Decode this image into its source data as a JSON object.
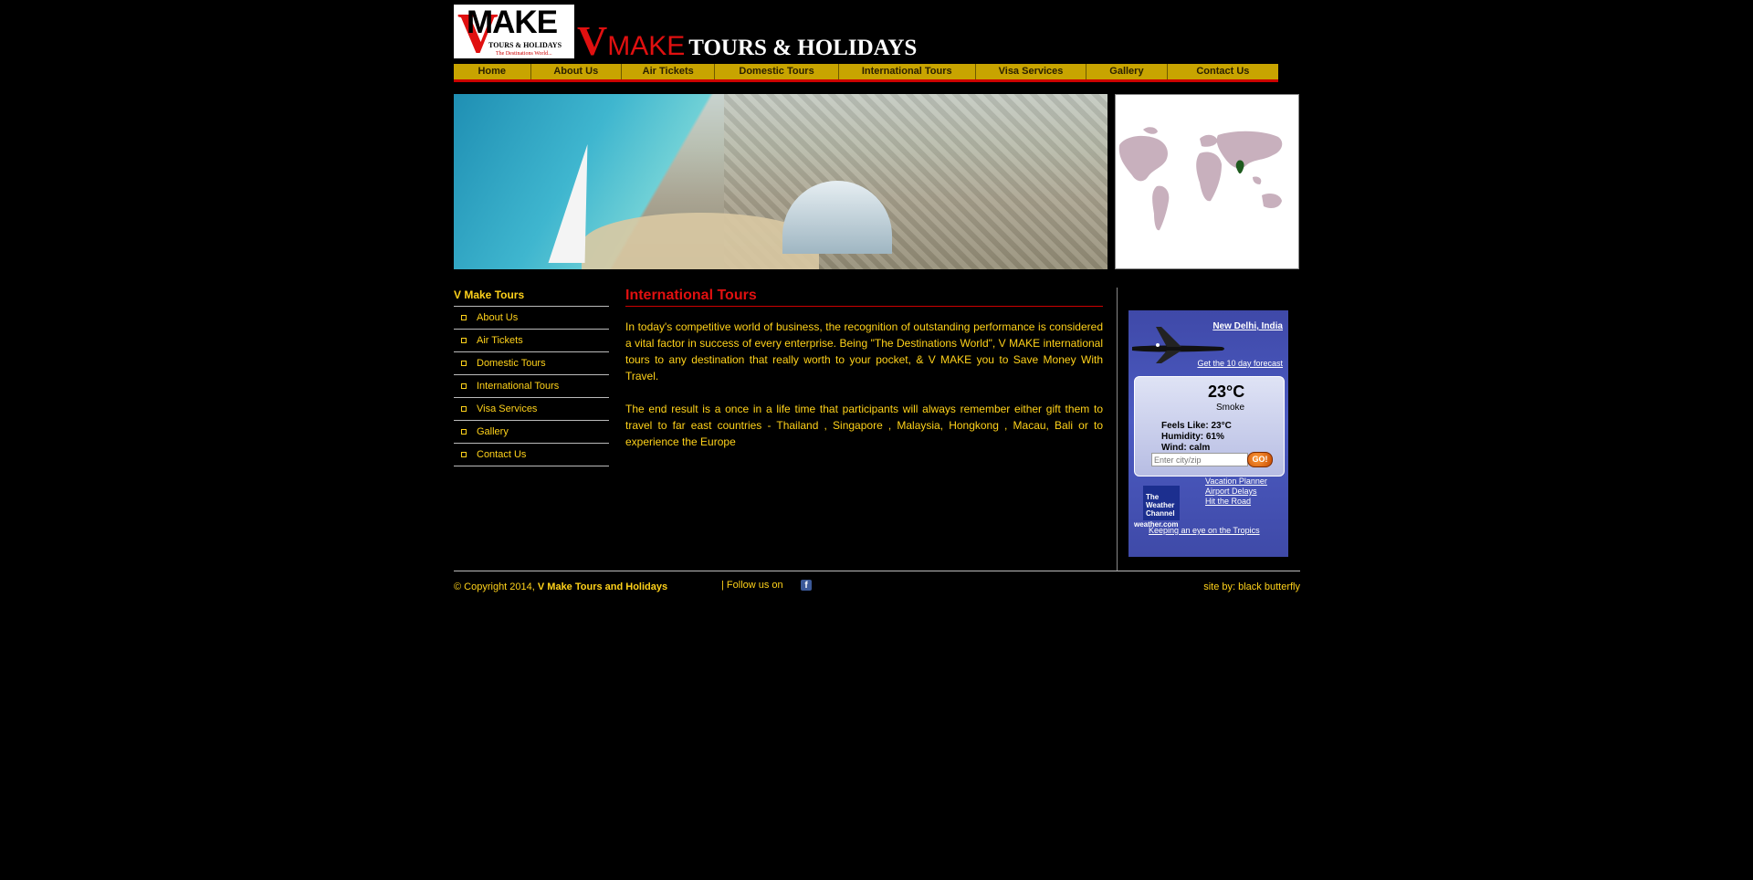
{
  "header": {
    "logo": {
      "v": "V",
      "make": "MAKE",
      "sub1": "TOURS & HOLIDAYS",
      "sub2": "The Destinations World..."
    },
    "brand": {
      "v": "V",
      "make": "MAKE",
      "rest": "TOURS & HOLIDAYS"
    }
  },
  "nav": {
    "items": [
      {
        "label": "Home"
      },
      {
        "label": "About Us"
      },
      {
        "label": "Air Tickets"
      },
      {
        "label": "Domestic Tours"
      },
      {
        "label": "International Tours"
      },
      {
        "label": "Visa Services"
      },
      {
        "label": "Gallery"
      },
      {
        "label": "Contact Us"
      }
    ]
  },
  "sidebar": {
    "title": "V Make Tours",
    "items": [
      {
        "label": "About Us"
      },
      {
        "label": "Air Tickets"
      },
      {
        "label": "Domestic Tours"
      },
      {
        "label": "International Tours"
      },
      {
        "label": "Visa Services"
      },
      {
        "label": "Gallery"
      },
      {
        "label": "Contact Us"
      }
    ]
  },
  "content": {
    "title": "International Tours",
    "p1": "In today's competitive world of business, the recognition of outstanding performance is considered a vital factor in success of every enterprise. Being \"The Destinations World\", V MAKE international tours to any destination that really worth to your pocket, & V MAKE you to Save Money With Travel.",
    "p2": "The end result is a once in a life time that participants will always remember either gift them to travel to far east countries - Thailand , Singapore , Malaysia, Hongkong , Macau, Bali or to experience the Europe"
  },
  "weather": {
    "city": "New Delhi, India",
    "forecast_link": "Get the 10 day forecast",
    "temp": "23°C",
    "condition": "Smoke",
    "feels": "Feels Like: 23°C",
    "humidity": "Humidity: 61%",
    "wind": "Wind: calm",
    "input_placeholder": "Enter city/zip",
    "go": "GO!",
    "logo": {
      "line1": "The",
      "line2": "Weather",
      "line3": "Channel",
      "site": "weather.com"
    },
    "links": [
      "Vacation Planner",
      "Airport Delays",
      "Hit the Road"
    ],
    "tropics": "Keeping an eye on the Tropics"
  },
  "footer": {
    "copyright_prefix": "© Copyright 2014, ",
    "copyright_name": "V Make Tours and Holidays",
    "follow": "|   Follow us on",
    "fb_icon": "f",
    "credit": "site by: black butterfly"
  },
  "colors": {
    "accent": "#ffd21a",
    "nav": "#c8a400",
    "red": "#e01010",
    "widget": "#4c5bc2"
  }
}
